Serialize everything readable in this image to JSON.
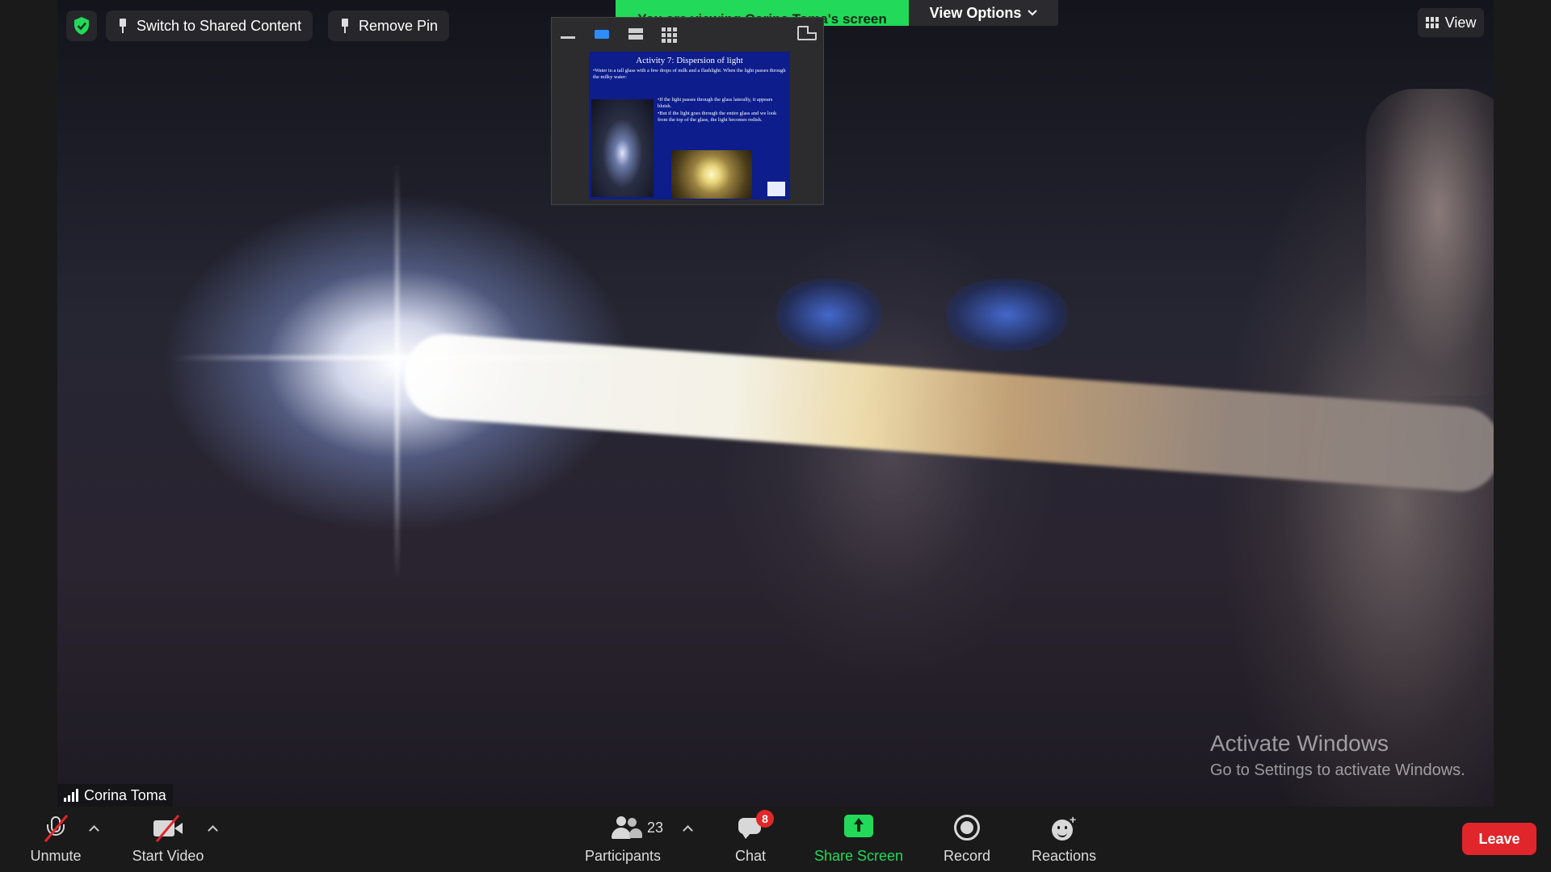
{
  "top_bar": {
    "switch_label": "Switch to Shared Content",
    "remove_pin_label": "Remove Pin",
    "banner_text": "You are viewing Corina Toma's screen",
    "view_options_label": "View Options",
    "view_label": "View"
  },
  "shared_slide": {
    "title": "Activity 7: Dispersion of light",
    "intro": "•Water in a tall glass with a few drops of milk and a flashlight. When the light passes through the milky water:",
    "bullet1": "•If the light passes through the glass laterally, it appears bluish.",
    "bullet2": "•But if the light goes through the entire glass and we look from the top of the glass, the light becomes redish."
  },
  "video": {
    "participant_name": "Corina Toma"
  },
  "watermark": {
    "line1": "Activate Windows",
    "line2": "Go to Settings to activate Windows."
  },
  "toolbar": {
    "unmute_label": "Unmute",
    "start_video_label": "Start Video",
    "participants_label": "Participants",
    "participants_count": "23",
    "chat_label": "Chat",
    "chat_badge": "8",
    "share_screen_label": "Share Screen",
    "record_label": "Record",
    "reactions_label": "Reactions",
    "leave_label": "Leave"
  },
  "colors": {
    "banner_green": "#23d959",
    "leave_red": "#e0262b",
    "accent_blue": "#2d8cff",
    "badge_red": "#e02828"
  },
  "icons": [
    "shield-check-icon",
    "pin-icon",
    "chevron-down-icon",
    "grid-icon",
    "signal-icon",
    "mic-muted-icon",
    "video-off-icon",
    "participants-icon",
    "chat-icon",
    "share-screen-icon",
    "record-icon",
    "reactions-icon"
  ]
}
